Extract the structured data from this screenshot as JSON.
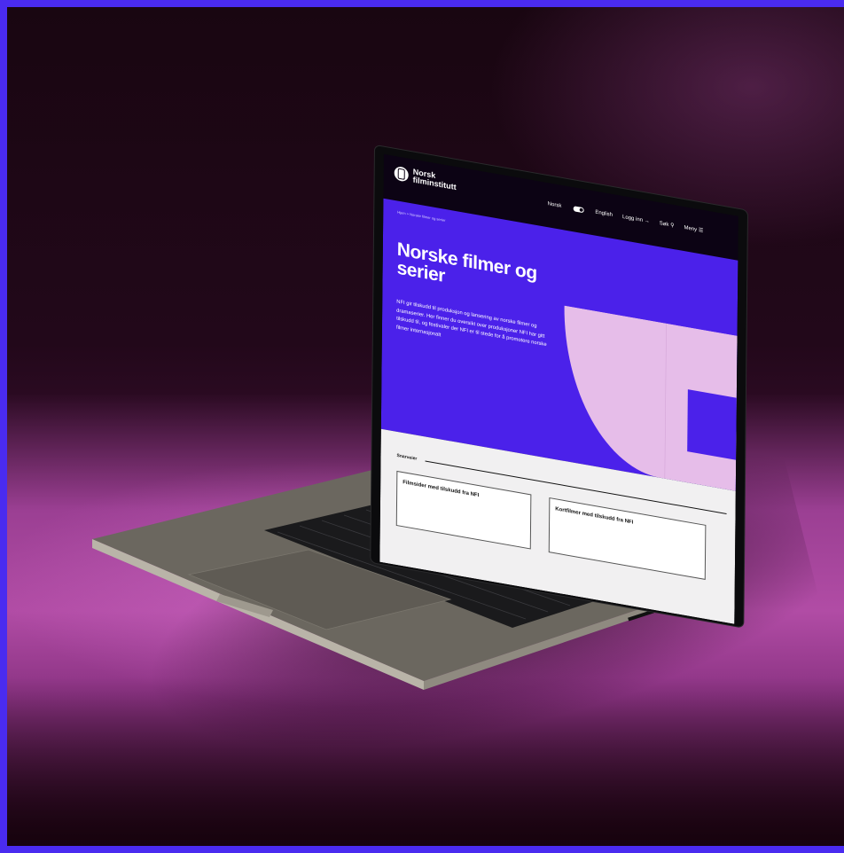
{
  "site": {
    "logo_line1": "Norsk",
    "logo_line2": "filminstitutt",
    "breadcrumb": "Hjem  >  Norske filmer og serier",
    "nav": {
      "lang_norsk": "Norsk",
      "lang_english": "English",
      "login": "Logg inn",
      "search": "Søk",
      "menu": "Meny"
    },
    "title": "Norske filmer og serier",
    "intro": "NFI gir tilskudd til produksjon og lansering av norske filmer og dramaserier. Her finner du oversikt over produksjoner NFI har gitt tilskudd til, og festivaler der NFI er til stede for å promotere norske filmer internasjonalt",
    "shortcuts_label": "Snarveier",
    "card1": "Filmsider med tilskudd fra NFI",
    "card2": "Kortfilmer med tilskudd fra NFI"
  },
  "colors": {
    "frame_accent": "#4a2bf0",
    "hero_blue": "#4b21ea",
    "hero_pink": "#e6bde9",
    "background_magenta": "#b14ca5"
  },
  "icons": {
    "login": "arrow-right-icon",
    "search": "search-icon",
    "menu": "hamburger-icon"
  }
}
